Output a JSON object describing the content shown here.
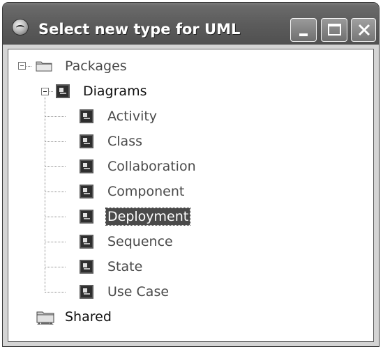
{
  "window": {
    "title": "Select new type for UML",
    "app_icon": "globe-icon",
    "buttons": {
      "minimize": "minimize-icon",
      "maximize": "maximize-icon",
      "close": "close-icon"
    }
  },
  "tree": {
    "root": {
      "label": "Packages",
      "icon": "folder-icon",
      "expanded": true
    },
    "diagrams": {
      "label": "Diagrams",
      "icon": "diagram-icon",
      "expanded": true
    },
    "items": [
      {
        "label": "Activity"
      },
      {
        "label": "Class"
      },
      {
        "label": "Collaboration"
      },
      {
        "label": "Component"
      },
      {
        "label": "Deployment",
        "selected": true
      },
      {
        "label": "Sequence"
      },
      {
        "label": "State"
      },
      {
        "label": "Use Case"
      }
    ],
    "shared": {
      "label": "Shared",
      "icon": "shared-folder-icon"
    }
  }
}
